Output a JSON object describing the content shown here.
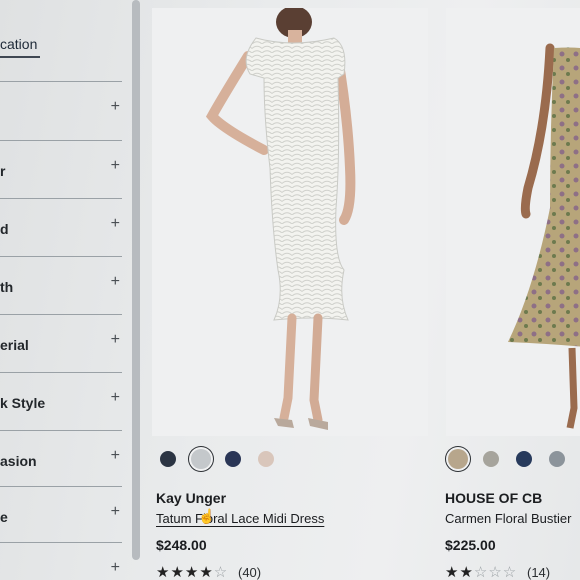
{
  "sidebar": {
    "header": "cation",
    "filters": [
      {
        "label": ""
      },
      {
        "label": "r"
      },
      {
        "label": "d"
      },
      {
        "label": "th"
      },
      {
        "label": "erial"
      },
      {
        "label": "k Style"
      },
      {
        "label": "asion"
      },
      {
        "label": "e"
      },
      {
        "label": ""
      }
    ],
    "plus_symbol": "+"
  },
  "products": [
    {
      "brand": "Kay Unger",
      "name": "Tatum Floral Lace Midi Dress",
      "price": "$248.00",
      "rating_stars": 4.5,
      "rating_count": "(40)",
      "swatches": [
        "#2b3443",
        "#c4c8cb",
        "#2a3656",
        "#d9c6bb"
      ],
      "selected_swatch": 1
    },
    {
      "brand": "HOUSE OF CB",
      "name": "Carmen Floral Bustier",
      "price": "$225.00",
      "rating_stars": 2.5,
      "rating_count": "(14)",
      "swatches": [
        "#b7a68c",
        "#a6a49c",
        "#273a5c",
        "#8c949b"
      ],
      "selected_swatch": 0
    }
  ],
  "icons": {
    "cursor": "hand-pointer-icon"
  }
}
